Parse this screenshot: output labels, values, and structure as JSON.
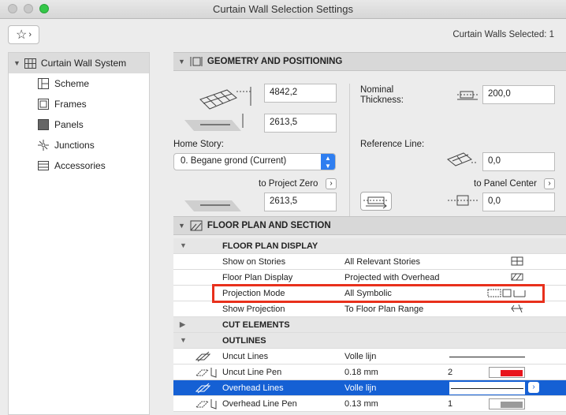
{
  "window": {
    "title": "Curtain Wall Selection Settings"
  },
  "header": {
    "selected_count": "Curtain Walls Selected: 1",
    "favorites_icon": "star-icon"
  },
  "sidebar": {
    "root": "Curtain Wall System",
    "items": [
      {
        "label": "Scheme",
        "icon": "scheme-icon"
      },
      {
        "label": "Frames",
        "icon": "frames-icon"
      },
      {
        "label": "Panels",
        "icon": "panels-icon"
      },
      {
        "label": "Junctions",
        "icon": "junctions-icon"
      },
      {
        "label": "Accessories",
        "icon": "accessories-icon"
      }
    ]
  },
  "geometry": {
    "title": "GEOMETRY AND POSITIONING",
    "height_value": "4842,2",
    "bottom_offset_value": "2613,5",
    "nominal_thickness_label": "Nominal Thickness:",
    "nominal_thickness_value": "200,0",
    "home_story_label": "Home Story:",
    "home_story_value": "0. Begane grond (Current)",
    "to_project_zero_label": "to Project Zero",
    "to_project_zero_value": "2613,5",
    "reference_line_label": "Reference Line:",
    "reference_line_value": "0,0",
    "to_panel_center_label": "to Panel Center",
    "to_panel_center_value": "0,0"
  },
  "floor_plan": {
    "title": "FLOOR PLAN AND SECTION",
    "groups": {
      "display": "FLOOR PLAN DISPLAY",
      "cut": "CUT ELEMENTS",
      "outlines": "OUTLINES"
    },
    "display_rows": [
      {
        "name": "Show on Stories",
        "value": "All Relevant Stories"
      },
      {
        "name": "Floor Plan Display",
        "value": "Projected with Overhead"
      },
      {
        "name": "Projection Mode",
        "value": "All Symbolic"
      },
      {
        "name": "Show Projection",
        "value": "To Floor Plan Range"
      }
    ],
    "outline_rows": [
      {
        "name": "Uncut Lines",
        "value": "Volle lijn"
      },
      {
        "name": "Uncut Line Pen",
        "value": "0.18 mm",
        "pen": "2",
        "color": "#e8141c"
      },
      {
        "name": "Overhead Lines",
        "value": "Volle lijn"
      },
      {
        "name": "Overhead Line Pen",
        "value": "0.13 mm",
        "pen": "1",
        "color": "#9a9a9a"
      }
    ]
  },
  "colors": {
    "accent": "#1560d4",
    "highlight": "#e8301c",
    "toggle": "#2f7ef0"
  }
}
